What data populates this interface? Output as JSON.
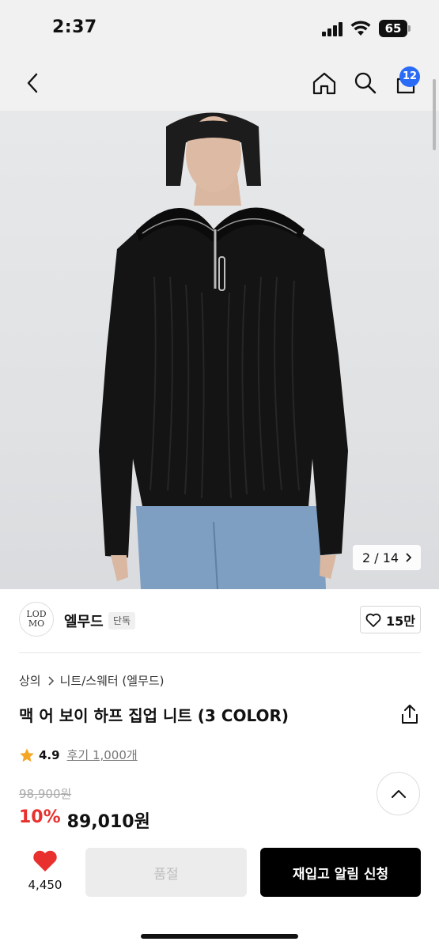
{
  "status": {
    "time": "2:37",
    "battery": "65"
  },
  "nav": {
    "cart_count": "12",
    "icons": [
      "chevron-left-icon",
      "home-icon",
      "search-icon",
      "shopping-bag-icon"
    ]
  },
  "hero": {
    "counter_current": "2",
    "counter_sep": "/",
    "counter_total": "14"
  },
  "brand": {
    "logo_text_top": "LOD",
    "logo_text_bottom": "MO",
    "name": "엘무드",
    "badge": "단독",
    "likes": "15만"
  },
  "breadcrumb": {
    "category": "상의",
    "subcategory": "니트/스웨터 (엘무드)"
  },
  "product": {
    "title": "맥 어 보이 하프 집업 니트 (3 COLOR)"
  },
  "rating": {
    "value": "4.9",
    "reviews": "후기 1,000개"
  },
  "price": {
    "original": "98,900원",
    "discount": "10%",
    "final": "89,010원"
  },
  "actions": {
    "wish_count": "4,450",
    "soldout_label": "품절",
    "restock_label": "재입고 알림 신청"
  },
  "colors": {
    "accent_blue": "#2b6cf6",
    "discount_red": "#e8302e",
    "heart_red": "#e8302e",
    "star": "#f5a623"
  }
}
